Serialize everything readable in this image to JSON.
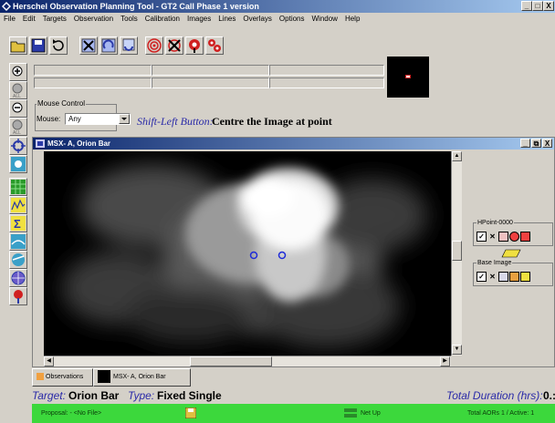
{
  "app": {
    "title": "Herschel Observation Planning Tool - GT2 Call Phase 1 version"
  },
  "window_buttons": {
    "minimize": "_",
    "maximize": "□",
    "close": "X"
  },
  "menu": [
    "File",
    "Edit",
    "Targets",
    "Observation",
    "Tools",
    "Calibration",
    "Images",
    "Lines",
    "Overlays",
    "Options",
    "Window",
    "Help"
  ],
  "toolbar": {
    "icons": [
      "open-folder-icon",
      "save-icon",
      "undo-icon",
      "aor-delete-icon",
      "aor-cycle-icon",
      "aor-stack-icon",
      "target-icon",
      "target-delete-icon",
      "target-flag-icon",
      "target-group-icon"
    ]
  },
  "mouse_control": {
    "legend": "Mouse Control",
    "label": "Mouse:",
    "value": "Any",
    "hint_italic": "Shift-Left Button:",
    "hint_text": "Centre the Image at point"
  },
  "sidebar": {
    "icons": [
      "zoom-in-icon",
      "zoom-all-icon",
      "zoom-out-icon",
      "zoom-out-all-icon",
      "crosshair-icon",
      "target-point-icon",
      "grid-overlay-icon",
      "spectrum-icon",
      "sum-icon",
      "sky-map-icon",
      "view-icon",
      "globe-icon",
      "pin-icon"
    ]
  },
  "image_window": {
    "title": "MSX- A,  Orion Bar",
    "controls": {
      "minimize": "_",
      "restore": "⧉",
      "close": "X"
    }
  },
  "right_panel": {
    "group1": "HPoint-0000",
    "group2": "Base Image"
  },
  "tabs": [
    {
      "label": "Observations"
    },
    {
      "label": "MSX- A,  Orion Bar"
    }
  ],
  "info": {
    "target_label": "Target:",
    "target_value": "Orion Bar",
    "type_label": "Type:",
    "type_value": "Fixed Single",
    "duration_label": "Total Duration (hrs):",
    "duration_value": "0.:"
  },
  "status": {
    "proposal": "Proposal: - <No File>",
    "net": "Net Up",
    "aors": "Total AORs 1  / Active: 1"
  },
  "colors": {
    "titlebar": "#0a246a",
    "status_green": "#3cd83c",
    "overlay_circle": "#1e2bd8"
  }
}
